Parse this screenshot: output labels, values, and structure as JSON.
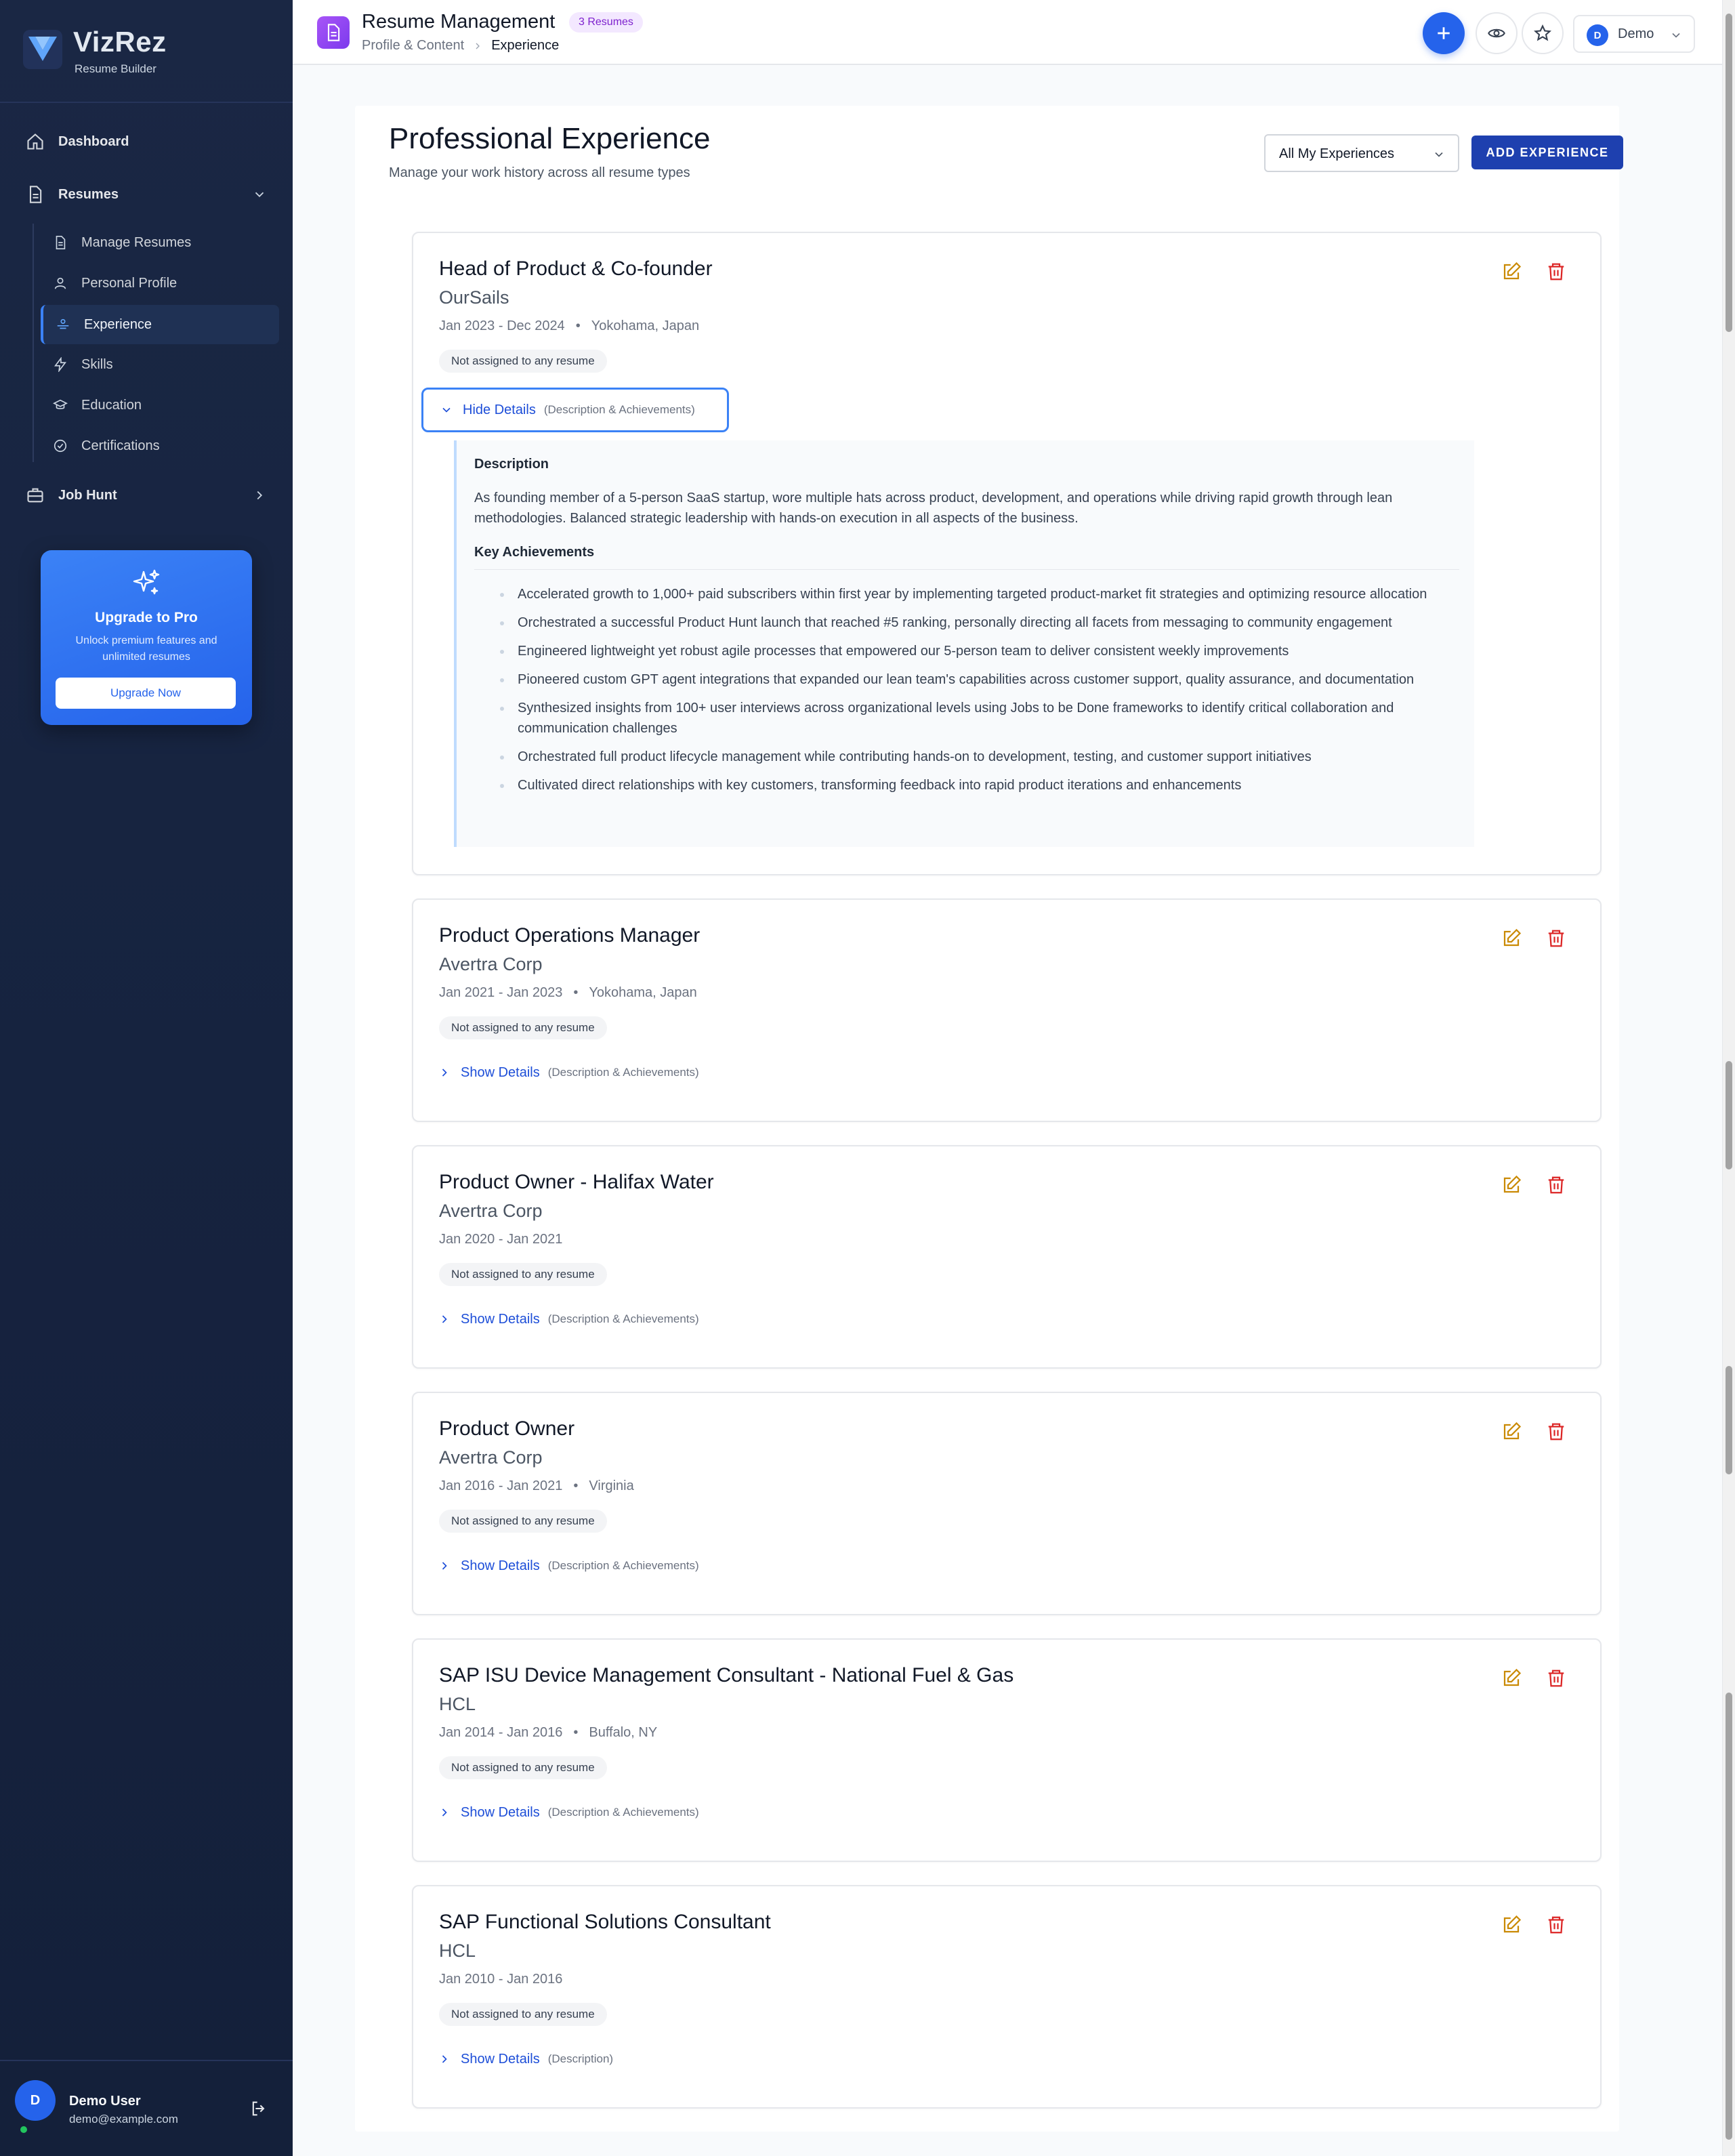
{
  "brand": {
    "name": "VizRez",
    "subtitle": "Resume Builder"
  },
  "sidebar": {
    "dashboard": "Dashboard",
    "resumes": "Resumes",
    "sub_items": [
      "Manage Resumes",
      "Personal Profile",
      "Experience",
      "Skills",
      "Education",
      "Certifications"
    ],
    "active_item": "Experience",
    "job_hunt": "Job Hunt"
  },
  "upgrade": {
    "title": "Upgrade to Pro",
    "desc": "Unlock premium features and unlimited resumes",
    "button": "Upgrade Now"
  },
  "user": {
    "initial": "D",
    "name": "Demo User",
    "email": "demo@example.com"
  },
  "header": {
    "title": "Resume Management",
    "badge": "3 Resumes",
    "breadcrumb": [
      "Profile & Content",
      "Experience"
    ],
    "user_initial": "D",
    "user_name": "Demo"
  },
  "page": {
    "title": "Professional Experience",
    "subtitle": "Manage your work history across all resume types",
    "filter": "All My Experiences",
    "add_button": "ADD EXPERIENCE"
  },
  "labels": {
    "hide_details": "Hide Details",
    "show_details": "Show Details",
    "description_heading": "Description",
    "achievements_heading": "Key Achievements"
  },
  "experiences": [
    {
      "title": "Head of Product & Co-founder",
      "company": "OurSails",
      "dates": "Jan 2023 - Dec 2024",
      "location": "Yokohama, Japan",
      "tag": "Not assigned to any resume",
      "hint": "(Description & Achievements)",
      "expanded": true,
      "description": "As founding member of a 5-person SaaS startup, wore multiple hats across product, development, and operations while driving rapid growth through lean methodologies. Balanced strategic leadership with hands-on execution in all aspects of the business.",
      "achievements": [
        "Accelerated growth to 1,000+ paid subscribers within first year by implementing targeted product-market fit strategies and optimizing resource allocation",
        "Orchestrated a successful Product Hunt launch that reached #5 ranking, personally directing all facets from messaging to community engagement",
        "Engineered lightweight yet robust agile processes that empowered our 5-person team to deliver consistent weekly improvements",
        "Pioneered custom GPT agent integrations that expanded our lean team's capabilities across customer support, quality assurance, and documentation",
        "Synthesized insights from 100+ user interviews across organizational levels using Jobs to be Done frameworks to identify critical collaboration and communication challenges",
        "Orchestrated full product lifecycle management while contributing hands-on to development, testing, and customer support initiatives",
        "Cultivated direct relationships with key customers, transforming feedback into rapid product iterations and enhancements"
      ]
    },
    {
      "title": "Product Operations Manager",
      "company": "Avertra Corp",
      "dates": "Jan 2021 - Jan 2023",
      "location": "Yokohama, Japan",
      "tag": "Not assigned to any resume",
      "hint": "(Description & Achievements)",
      "expanded": false
    },
    {
      "title": "Product Owner - Halifax Water",
      "company": "Avertra Corp",
      "dates": "Jan 2020 - Jan 2021",
      "location": "",
      "tag": "Not assigned to any resume",
      "hint": "(Description & Achievements)",
      "expanded": false
    },
    {
      "title": "Product Owner",
      "company": "Avertra Corp",
      "dates": "Jan 2016 - Jan 2021",
      "location": "Virginia",
      "tag": "Not assigned to any resume",
      "hint": "(Description & Achievements)",
      "expanded": false
    },
    {
      "title": "SAP ISU Device Management Consultant - National Fuel & Gas",
      "company": "HCL",
      "dates": "Jan 2014 - Jan 2016",
      "location": "Buffalo, NY",
      "tag": "Not assigned to any resume",
      "hint": "(Description & Achievements)",
      "expanded": false
    },
    {
      "title": "SAP Functional Solutions Consultant",
      "company": "HCL",
      "dates": "Jan 2010 - Jan 2016",
      "location": "",
      "tag": "Not assigned to any resume",
      "hint": "(Description)",
      "expanded": false
    }
  ],
  "colors": {
    "accent": "#2563eb",
    "primary_button": "#1e40af",
    "edit": "#ca8a04",
    "delete": "#dc2626",
    "sidebar": "#1a2744"
  },
  "icons": {
    "edit": "edit-icon",
    "delete": "trash-icon",
    "add": "plus-icon",
    "preview": "eye-icon",
    "favorite": "star-icon"
  }
}
